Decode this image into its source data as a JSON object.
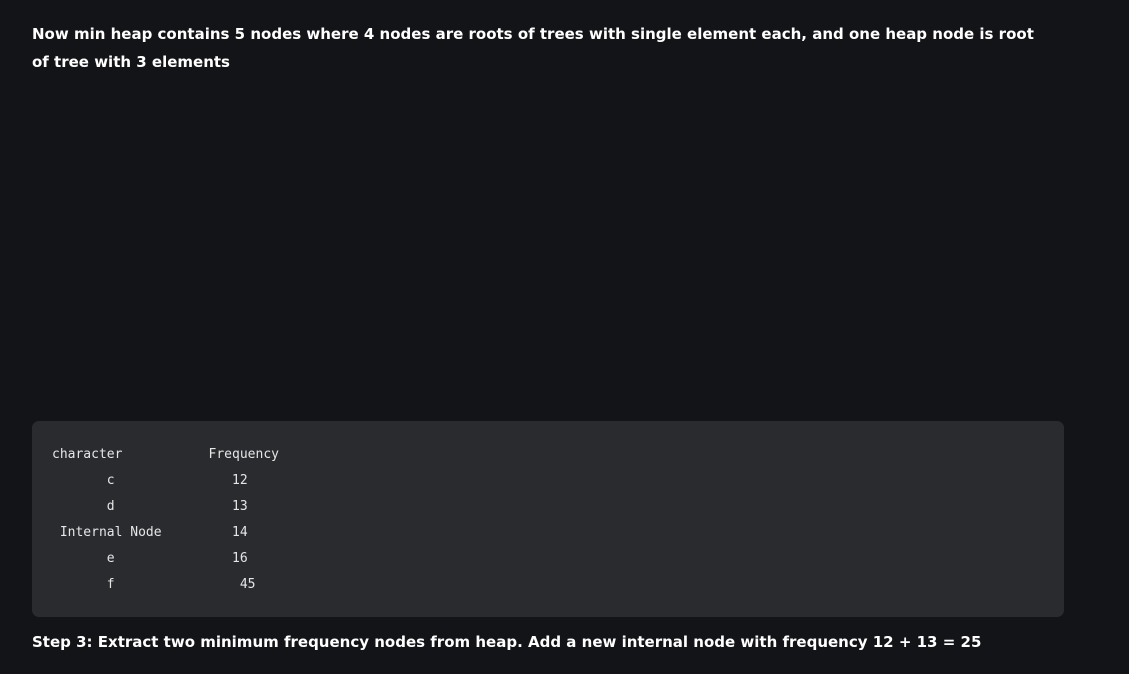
{
  "intro_text": "Now min heap contains 5 nodes where 4 nodes are roots of trees with single element each, and one heap node is root of tree with 3 elements",
  "code_block": {
    "lines": [
      "character           Frequency",
      "       c               12",
      "       d               13",
      " Internal Node         14",
      "       e               16",
      "       f                45"
    ]
  },
  "step": {
    "label": "Step 3:",
    "text": " Extract two minimum frequency nodes from heap. Add a new internal node with frequency 12 + 13 = 25"
  }
}
